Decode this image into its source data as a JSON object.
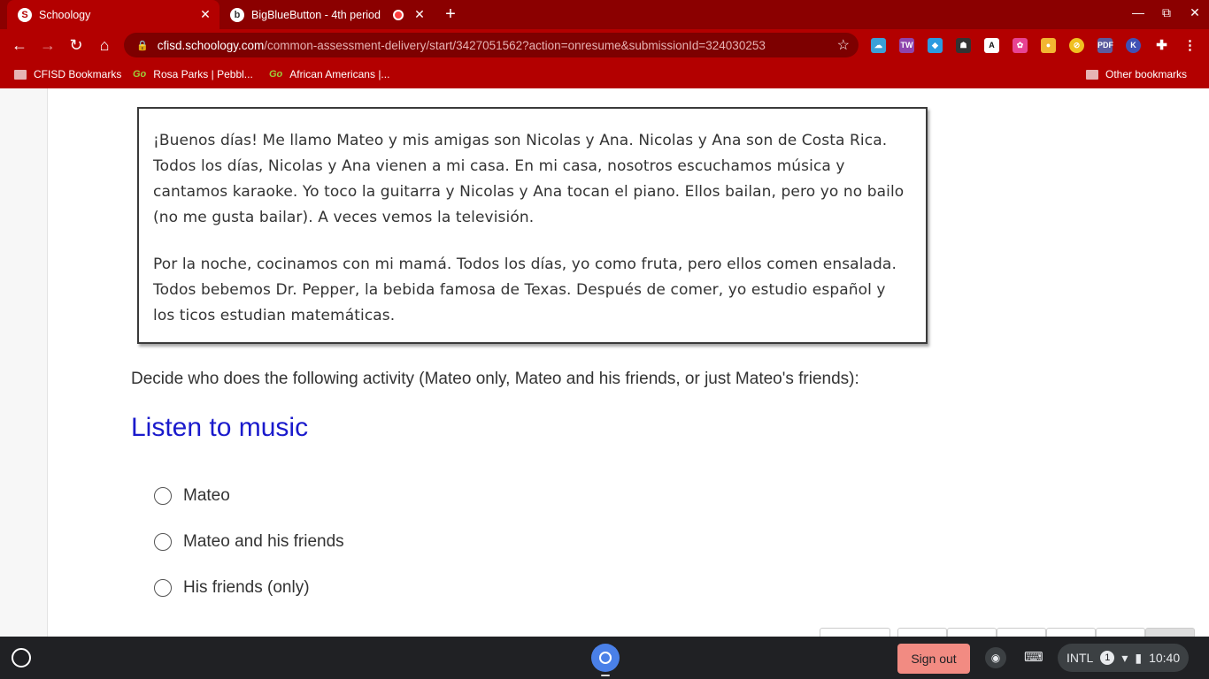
{
  "browser": {
    "tabs": [
      {
        "title": "Schoology",
        "favicon": "S",
        "active": true
      },
      {
        "title": "BigBlueButton - 4th period",
        "favicon": "b",
        "active": false,
        "recording": true
      }
    ],
    "url_host": "cfisd.schoology.com",
    "url_path": "/common-assessment-delivery/start/3427051562?action=onresume&submissionId=324030253",
    "bookmarks": [
      "CFISD Bookmarks",
      "Rosa Parks | Pebbl...",
      "African Americans |..."
    ],
    "other_bookmarks": "Other bookmarks",
    "colors": {
      "frame": "#8b0000",
      "toolbar": "#b30000"
    }
  },
  "passage": {
    "paragraph1": "¡Buenos días!  Me llamo Mateo y mis amigas son Nicolas y Ana.  Nicolas y Ana son de Costa Rica.  Todos los días, Nicolas y Ana vienen a mi casa. En mi casa, nosotros escuchamos música y cantamos karaoke.  Yo toco la guitarra y Nicolas y Ana tocan el piano.  Ellos bailan, pero yo no bailo (no me gusta bailar).    A veces vemos la televisión.",
    "paragraph2": "Por la noche, cocinamos con mi mamá.  Todos los días, yo como fruta, pero ellos comen ensalada.  Todos bebemos Dr. Pepper, la bebida famosa de Texas.  Después de comer, yo estudio español y los ticos estudian matemáticas."
  },
  "question": {
    "instructions": "Decide who does the following activity (Mateo only, Mateo and his friends, or just Mateo's friends):",
    "title": "Listen to music",
    "title_color": "#1a1acc",
    "options": [
      "Mateo",
      "Mateo and his friends",
      "His friends (only)"
    ]
  },
  "shelf": {
    "sign_out": "Sign out",
    "input_method": "INTL",
    "notification_count": "1",
    "time": "10:40"
  }
}
